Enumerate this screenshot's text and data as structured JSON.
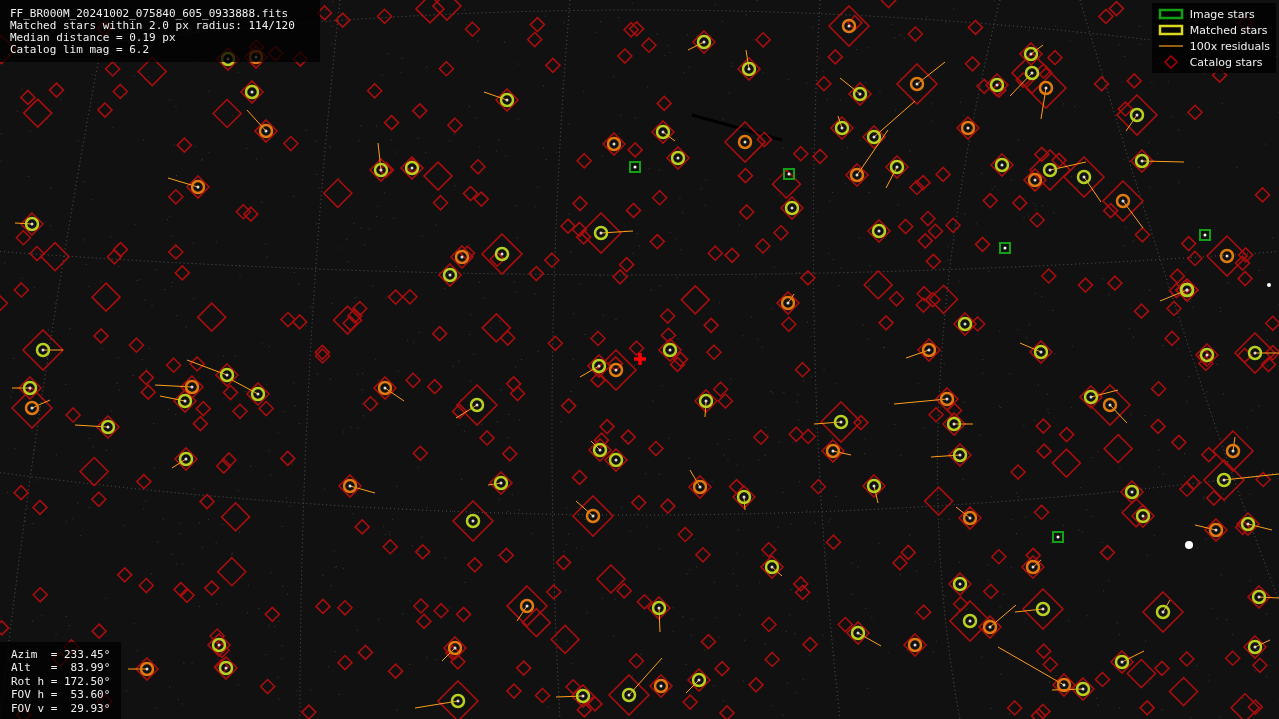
{
  "header": {
    "lines": [
      "FF_BR000M_20241002_075840_605_0933888.fits",
      "Matched stars within 2.0 px radius: 114/120",
      "Median distance = 0.19 px",
      "Catalog lim mag = 6.2"
    ]
  },
  "legend": [
    {
      "kind": "image",
      "label": "Image stars"
    },
    {
      "kind": "matched",
      "label": "Matched stars"
    },
    {
      "kind": "residual",
      "label": "100x residuals"
    },
    {
      "kind": "catalog",
      "label": "Catalog stars"
    }
  ],
  "pointing": {
    "lines": [
      "Azim  = 233.45°",
      "Alt   =  83.99°",
      "Rot h = 172.50°",
      "FOV h =  53.60°",
      "FOV v =  29.93°"
    ]
  }
}
